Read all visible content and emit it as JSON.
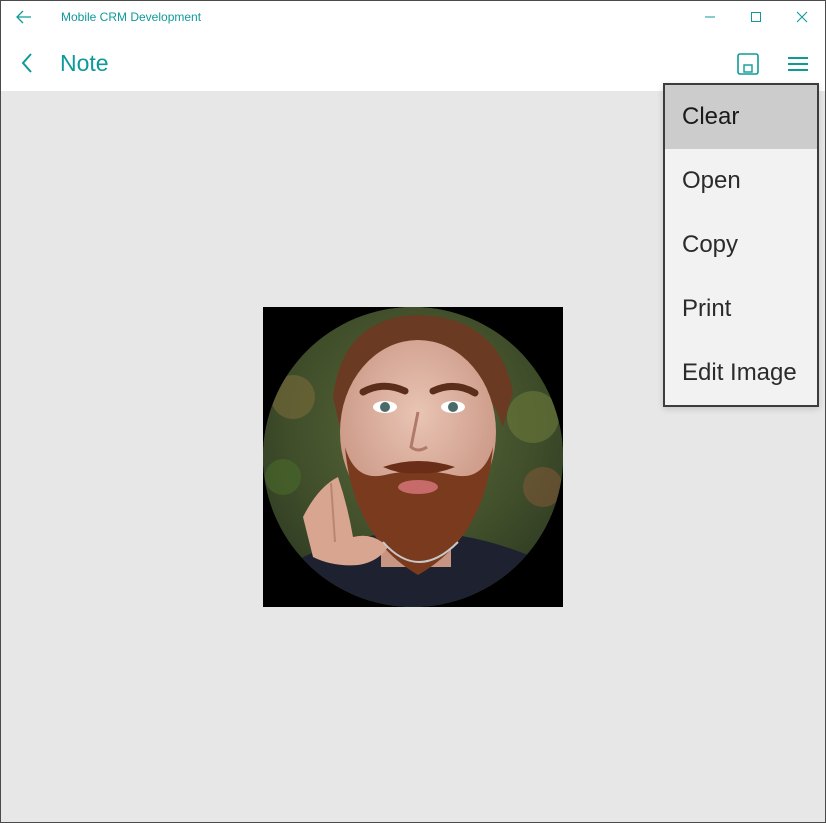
{
  "window": {
    "app_title": "Mobile CRM Development"
  },
  "header": {
    "page_title": "Note"
  },
  "menu": {
    "items": [
      {
        "label": "Clear",
        "selected": true
      },
      {
        "label": "Open",
        "selected": false
      },
      {
        "label": "Copy",
        "selected": false
      },
      {
        "label": "Print",
        "selected": false
      },
      {
        "label": "Edit Image",
        "selected": false
      }
    ]
  },
  "colors": {
    "accent": "#0f9a9a",
    "content_bg": "#e7e7e7",
    "menu_bg": "#f2f2f2",
    "menu_selected_bg": "#cccccc"
  },
  "icons": {
    "titlebar_back": "arrow-left-icon",
    "nav_back": "chevron-left-icon",
    "save": "save-icon",
    "menu": "hamburger-icon",
    "minimize": "minimize-icon",
    "maximize": "maximize-icon",
    "close": "close-icon"
  }
}
